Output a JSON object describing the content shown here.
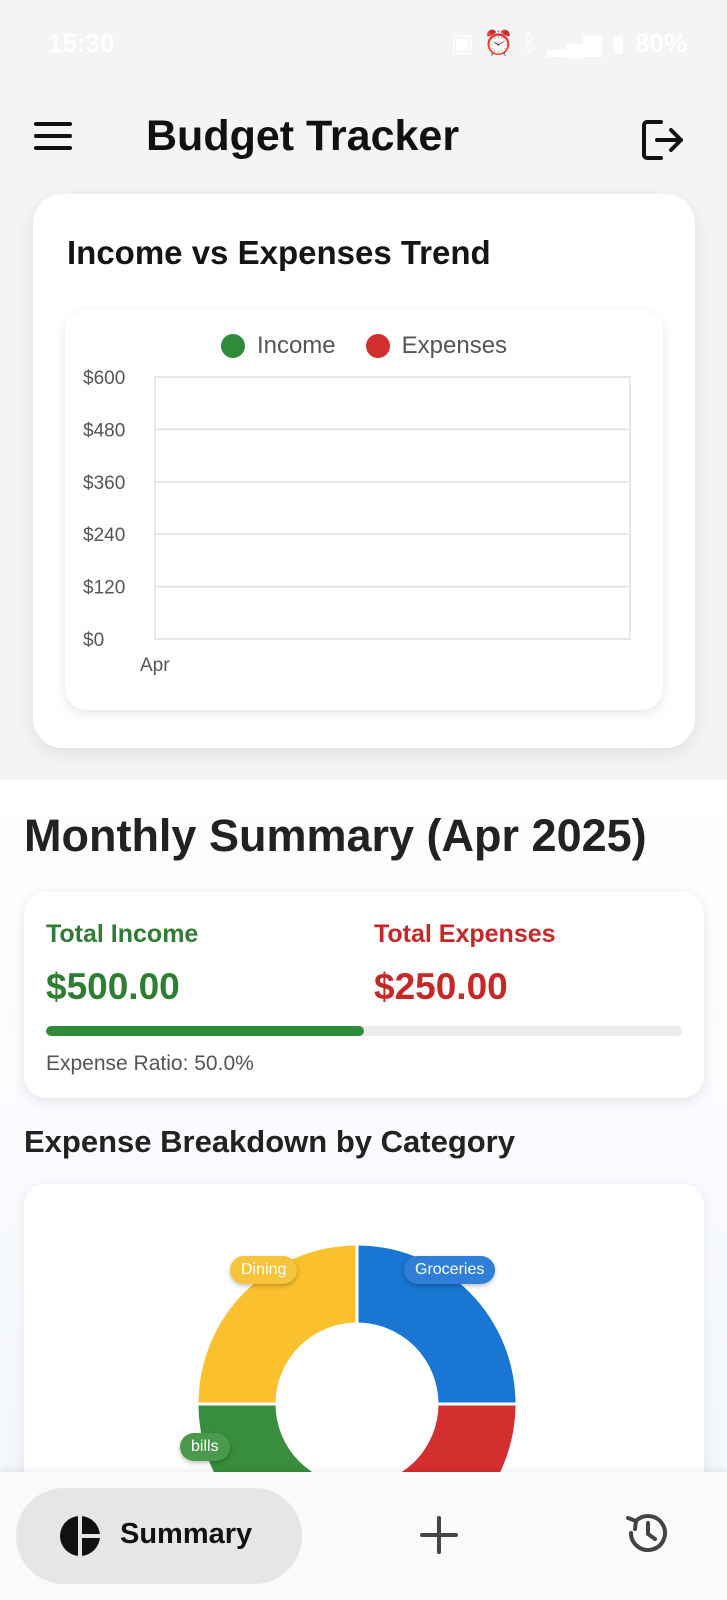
{
  "status_bar": {
    "time": "15:30",
    "battery": "80%"
  },
  "app_bar": {
    "title": "Budget Tracker",
    "menu_icon": "menu-icon",
    "logout_icon": "logout-icon"
  },
  "trend_card": {
    "title": "Income vs Expenses Trend",
    "legend": [
      {
        "label": "Income",
        "color": "#2e8b3a"
      },
      {
        "label": "Expenses",
        "color": "#d32f2f"
      }
    ]
  },
  "chart_data": {
    "type": "line",
    "title": "Income vs Expenses Trend",
    "categories": [
      "Apr"
    ],
    "series": [
      {
        "name": "Income",
        "values": []
      },
      {
        "name": "Expenses",
        "values": []
      }
    ],
    "y_ticks": [
      "$600",
      "$480",
      "$360",
      "$240",
      "$120",
      "$0"
    ],
    "x_ticks": [
      "Apr"
    ],
    "ylim": [
      0,
      600
    ],
    "grid": true,
    "legend_position": "top-center"
  },
  "summary": {
    "title": "Monthly Summary (Apr 2025)",
    "income_label": "Total Income",
    "income_value": "$500.00",
    "expenses_label": "Total Expenses",
    "expenses_value": "$250.00",
    "expense_ratio": 0.5,
    "ratio_text": "Expense Ratio: 50.0%"
  },
  "breakdown": {
    "title": "Expense Breakdown by Category",
    "categories": [
      {
        "label": "Groceries",
        "color": "#1976d2"
      },
      {
        "label": "Dining",
        "color": "#fbc02d"
      },
      {
        "label": "bills",
        "color": "#388e3c"
      },
      {
        "label": "",
        "color": "#d32f2f"
      }
    ]
  },
  "bottom_nav": {
    "summary_label": "Summary",
    "summary_icon": "pie-chart-icon",
    "add_icon": "plus-icon",
    "history_icon": "history-icon"
  }
}
